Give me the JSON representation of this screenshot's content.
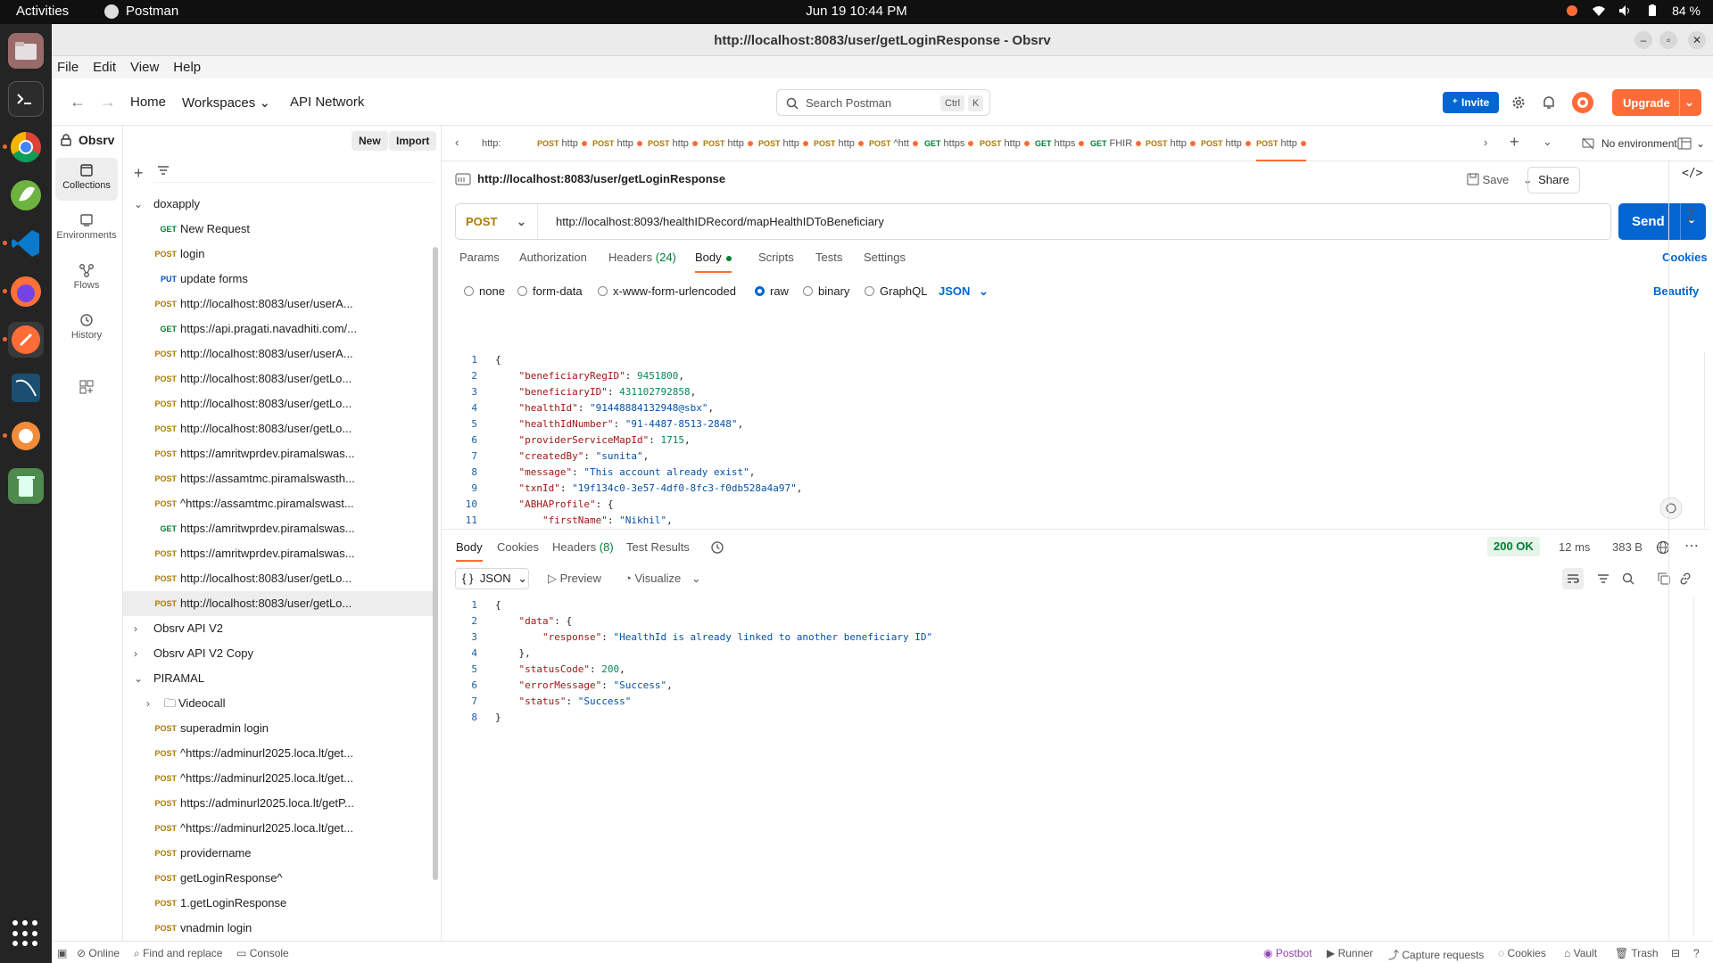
{
  "system": {
    "activities": "Activities",
    "app_name": "Postman",
    "clock": "Jun 19  10:44 PM",
    "battery": "84 %"
  },
  "window": {
    "title": "http://localhost:8083/user/getLoginResponse - Obsrv"
  },
  "menu": [
    "File",
    "Edit",
    "View",
    "Help"
  ],
  "header": {
    "home": "Home",
    "workspaces": "Workspaces",
    "api_network": "API Network",
    "search_placeholder": "Search Postman",
    "shortcut_ctrl": "Ctrl",
    "shortcut_k": "K",
    "invite": "Invite",
    "upgrade": "Upgrade"
  },
  "sidebar": {
    "workspace_name": "Obsrv",
    "new_label": "New",
    "import_label": "Import",
    "rail": [
      {
        "label": "Collections",
        "icon": "collections-icon"
      },
      {
        "label": "Environments",
        "icon": "environments-icon"
      },
      {
        "label": "Flows",
        "icon": "flows-icon"
      },
      {
        "label": "History",
        "icon": "history-icon"
      }
    ],
    "tree": [
      {
        "type": "collection",
        "name": "doxapply",
        "open": true
      },
      {
        "type": "request",
        "method": "GET",
        "name": "New Request"
      },
      {
        "type": "request",
        "method": "POST",
        "name": "login"
      },
      {
        "type": "request",
        "method": "PUT",
        "name": "update forms"
      },
      {
        "type": "request",
        "method": "POST",
        "name": "http://localhost:8083/user/userA..."
      },
      {
        "type": "request",
        "method": "GET",
        "name": "https://api.pragati.navadhiti.com/..."
      },
      {
        "type": "request",
        "method": "POST",
        "name": "http://localhost:8083/user/userA..."
      },
      {
        "type": "request",
        "method": "POST",
        "name": "http://localhost:8083/user/getLo..."
      },
      {
        "type": "request",
        "method": "POST",
        "name": "http://localhost:8083/user/getLo..."
      },
      {
        "type": "request",
        "method": "POST",
        "name": "http://localhost:8083/user/getLo..."
      },
      {
        "type": "request",
        "method": "POST",
        "name": "https://amritwprdev.piramalswas..."
      },
      {
        "type": "request",
        "method": "POST",
        "name": "https://assamtmc.piramalswasth..."
      },
      {
        "type": "request",
        "method": "POST",
        "name": "^https://assamtmc.piramalswast..."
      },
      {
        "type": "request",
        "method": "GET",
        "name": "https://amritwprdev.piramalswas..."
      },
      {
        "type": "request",
        "method": "POST",
        "name": "https://amritwprdev.piramalswas..."
      },
      {
        "type": "request",
        "method": "POST",
        "name": "http://localhost:8083/user/getLo..."
      },
      {
        "type": "request",
        "method": "POST",
        "name": "http://localhost:8083/user/getLo...",
        "selected": true
      },
      {
        "type": "collection",
        "name": "Obsrv API V2",
        "open": false
      },
      {
        "type": "collection",
        "name": "Obsrv API V2 Copy",
        "open": false
      },
      {
        "type": "collection",
        "name": "PIRAMAL",
        "open": true
      },
      {
        "type": "folder",
        "name": "Videocall"
      },
      {
        "type": "request",
        "method": "POST",
        "name": "superadmin login"
      },
      {
        "type": "request",
        "method": "POST",
        "name": "^https://adminurl2025.loca.lt/get..."
      },
      {
        "type": "request",
        "method": "POST",
        "name": "^https://adminurl2025.loca.lt/get..."
      },
      {
        "type": "request",
        "method": "POST",
        "name": "https://adminurl2025.loca.lt/getP..."
      },
      {
        "type": "request",
        "method": "POST",
        "name": "^https://adminurl2025.loca.lt/get..."
      },
      {
        "type": "request",
        "method": "POST",
        "name": "providername"
      },
      {
        "type": "request",
        "method": "POST",
        "name": "getLoginResponse^"
      },
      {
        "type": "request",
        "method": "POST",
        "name": "1.getLoginResponse"
      },
      {
        "type": "request",
        "method": "POST",
        "name": "vnadmin login"
      }
    ]
  },
  "tabs": [
    {
      "method": "",
      "label": "http:",
      "dot": false
    },
    {
      "method": "POST",
      "label": "http",
      "dot": true
    },
    {
      "method": "POST",
      "label": "http",
      "dot": true
    },
    {
      "method": "POST",
      "label": "http",
      "dot": true
    },
    {
      "method": "POST",
      "label": "http",
      "dot": true
    },
    {
      "method": "POST",
      "label": "http",
      "dot": true
    },
    {
      "method": "POST",
      "label": "http",
      "dot": true
    },
    {
      "method": "POST",
      "label": "^htt",
      "dot": true
    },
    {
      "method": "GET",
      "label": "https",
      "dot": true
    },
    {
      "method": "POST",
      "label": "http",
      "dot": true
    },
    {
      "method": "GET",
      "label": "https",
      "dot": true
    },
    {
      "method": "GET",
      "label": "FHIR",
      "dot": true
    },
    {
      "method": "POST",
      "label": "http",
      "dot": true
    },
    {
      "method": "POST",
      "label": "http",
      "dot": true
    },
    {
      "method": "POST",
      "label": "http",
      "dot": true,
      "active": true
    }
  ],
  "environment": "No environment",
  "request": {
    "title": "http://localhost:8083/user/getLoginResponse",
    "save": "Save",
    "share": "Share",
    "method": "POST",
    "url": "http://localhost:8093/healthIDRecord/mapHealthIDToBeneficiary",
    "send": "Send",
    "tabs": {
      "params": "Params",
      "authorization": "Authorization",
      "headers": "Headers",
      "headers_count": "(24)",
      "body": "Body",
      "scripts": "Scripts",
      "tests": "Tests",
      "settings": "Settings"
    },
    "cookies": "Cookies",
    "body_types": [
      "none",
      "form-data",
      "x-www-form-urlencoded",
      "raw",
      "binary",
      "GraphQL"
    ],
    "selected_body_type": "raw",
    "format": "JSON",
    "beautify": "Beautify",
    "body_lines": [
      "{",
      "    \"beneficiaryRegID\": 9451800,",
      "    \"beneficiaryID\": 431102792858,",
      "    \"healthId\": \"91448884132948@sbx\",",
      "    \"healthIdNumber\": \"91-4487-8513-2848\",",
      "    \"providerServiceMapId\": 1715,",
      "    \"createdBy\": \"sunita\",",
      "    \"message\": \"This account already exist\",",
      "    \"txnId\": \"19f134c0-3e57-4df0-8fc3-f0db528a4a97\",",
      "    \"ABHAProfile\": {",
      "        \"firstName\": \"Nikhil\","
    ]
  },
  "response": {
    "tabs": {
      "body": "Body",
      "cookies": "Cookies",
      "headers": "Headers",
      "headers_count": "(8)",
      "test_results": "Test Results"
    },
    "status": "200 OK",
    "time": "12 ms",
    "size": "383 B",
    "format": "JSON",
    "preview": "Preview",
    "visualize": "Visualize",
    "lines": [
      "{",
      "    \"data\": {",
      "        \"response\": \"HealthId is already linked to another beneficiary ID\"",
      "    },",
      "    \"statusCode\": 200,",
      "    \"errorMessage\": \"Success\",",
      "    \"status\": \"Success\"",
      "}"
    ]
  },
  "statusbar": {
    "online": "Online",
    "find_replace": "Find and replace",
    "console": "Console",
    "postbot": "Postbot",
    "runner": "Runner",
    "capture": "Capture requests",
    "cookies": "Cookies",
    "vault": "Vault",
    "trash": "Trash"
  },
  "colors": {
    "accent": "#ff6c37",
    "primary": "#0265d2",
    "get": "#007f31",
    "post": "#ad7a03",
    "put": "#0053b8"
  }
}
